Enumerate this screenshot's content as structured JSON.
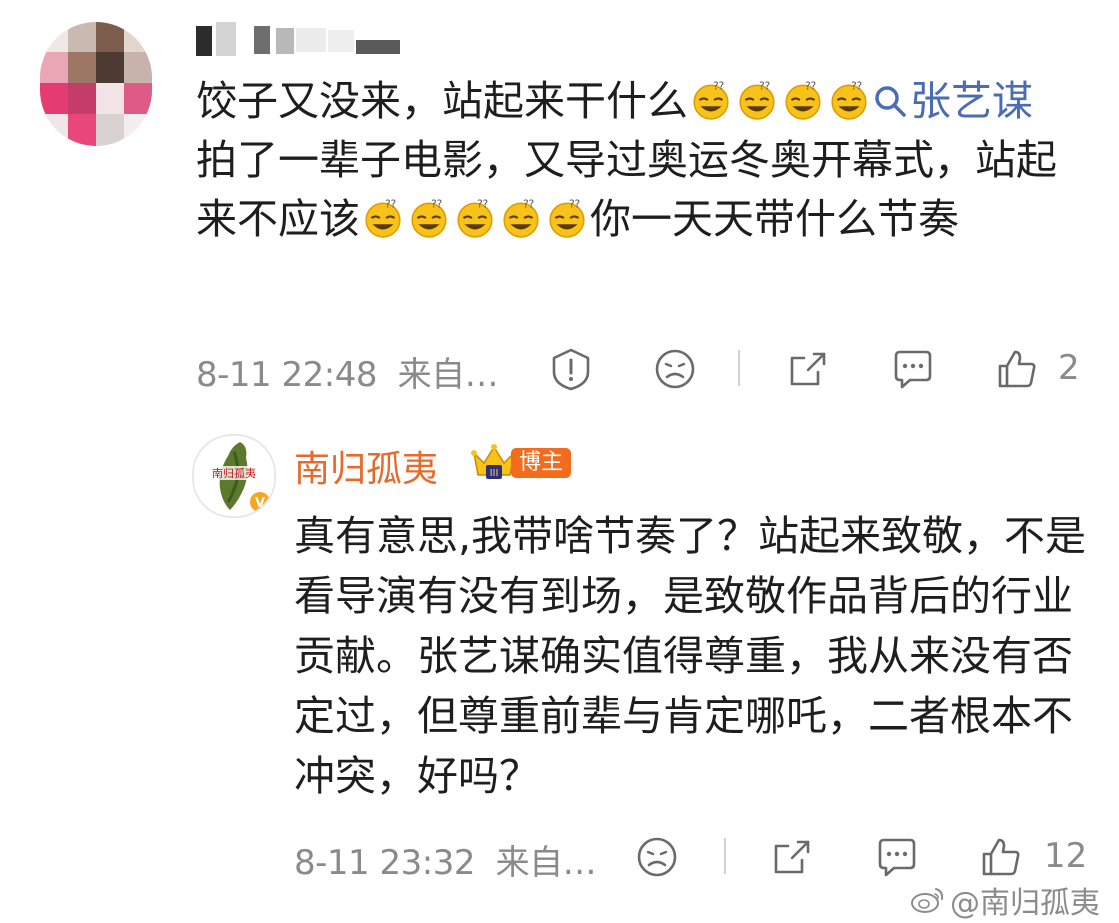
{
  "comment": {
    "text_part1": "饺子又没来，站起来干什么",
    "emoji_name": "doge-laugh-emoji",
    "mention": "张艺谋",
    "text_part2": " 拍了一辈子电影，又导过奥运冬奥开幕式，站起来不应该",
    "text_part3": "你一天天带什么节奏",
    "time": "8-11 22:48",
    "source": "来自…",
    "like_count": "2"
  },
  "reply": {
    "author": "南归孤夷",
    "badge": "博主",
    "avatar_text": "南归孤夷",
    "verified_mark": "V",
    "text": "真有意思,我带啥节奏了？站起来致敬，不是看导演有没有到场，是致敬作品背后的行业贡献。张艺谋确实值得尊重，我从来没有否定过，但尊重前辈与肯定哪吒，二者根本不冲突，好吗？",
    "time": "8-11 23:32",
    "source": "来自…",
    "like_count": "12"
  },
  "watermark": "@南归孤夷",
  "colors": {
    "mention": "#4a6cb3",
    "author": "#e66a2c",
    "badge": "#f36b1c",
    "meta": "#8a8a8a"
  }
}
